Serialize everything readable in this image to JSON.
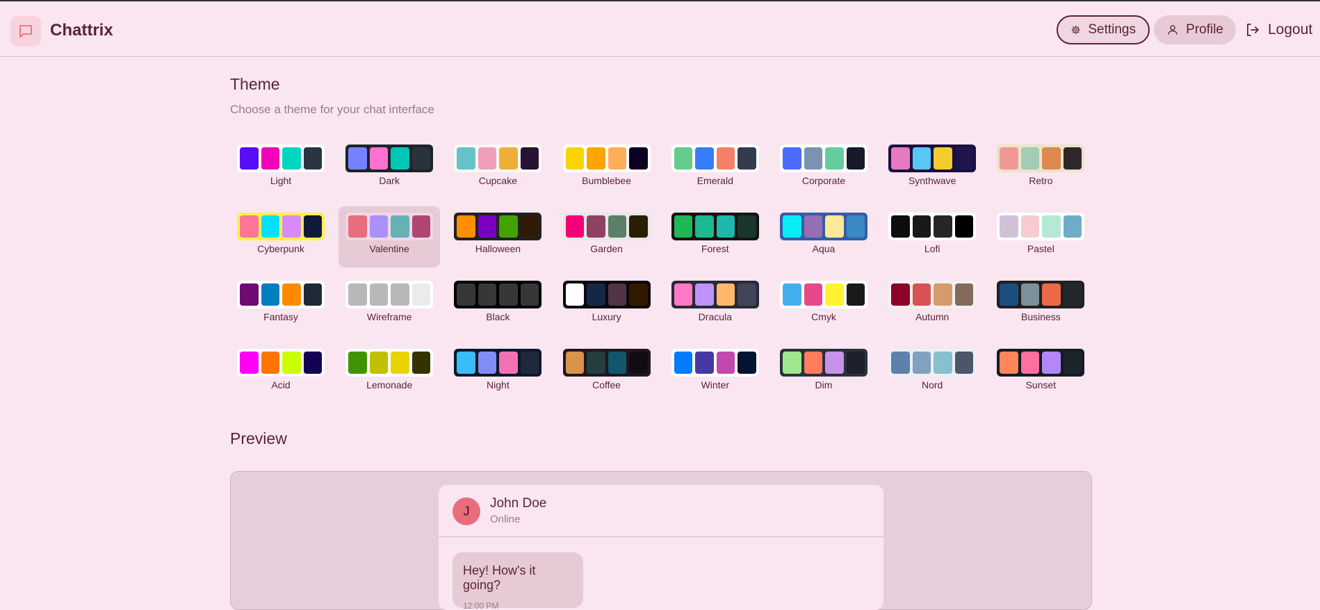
{
  "header": {
    "app_name": "Chattrix",
    "settings_label": "Settings",
    "profile_label": "Profile",
    "logout_label": "Logout"
  },
  "theme_section": {
    "title": "Theme",
    "subtitle": "Choose a theme for your chat interface",
    "selected": "Valentine"
  },
  "themes": [
    {
      "name": "Light",
      "bg": "#ffffff",
      "colors": [
        "#570df8",
        "#f000b8",
        "#00d7c0",
        "#2b3440"
      ]
    },
    {
      "name": "Dark",
      "bg": "#1d232a",
      "colors": [
        "#7582ff",
        "#ff71cf",
        "#00c7b5",
        "#2a323c"
      ]
    },
    {
      "name": "Cupcake",
      "bg": "#faf7f5",
      "colors": [
        "#65c3c8",
        "#ef9fbc",
        "#eeaf3a",
        "#291334"
      ]
    },
    {
      "name": "Bumblebee",
      "bg": "#ffffff",
      "colors": [
        "#fad302",
        "#ffa500",
        "#ffad57",
        "#0c0022"
      ]
    },
    {
      "name": "Emerald",
      "bg": "#ffffff",
      "colors": [
        "#66cc8a",
        "#377cfb",
        "#f68067",
        "#333c4d"
      ]
    },
    {
      "name": "Corporate",
      "bg": "#ffffff",
      "colors": [
        "#4b6bfb",
        "#7b92b2",
        "#67cba0",
        "#181a2a"
      ]
    },
    {
      "name": "Synthwave",
      "bg": "#1a103d",
      "colors": [
        "#e779c1",
        "#58c7f3",
        "#f3cc30",
        "#20134e"
      ]
    },
    {
      "name": "Retro",
      "bg": "#ece3ca",
      "colors": [
        "#ef9995",
        "#a4cbb4",
        "#dc8850",
        "#2e282a"
      ]
    },
    {
      "name": "Cyberpunk",
      "bg": "#fff248",
      "colors": [
        "#ff7598",
        "#00e1ff",
        "#d88af9",
        "#111a3b"
      ]
    },
    {
      "name": "Valentine",
      "bg": "#f0d6e8",
      "colors": [
        "#e96d7b",
        "#a991f7",
        "#66b1b3",
        "#af4670"
      ]
    },
    {
      "name": "Halloween",
      "bg": "#212121",
      "colors": [
        "#ff8f00",
        "#7a00c3",
        "#42a200",
        "#2f1b05"
      ]
    },
    {
      "name": "Garden",
      "bg": "#e9e7e7",
      "colors": [
        "#f40076",
        "#8e4162",
        "#5c7f67",
        "#291e00"
      ]
    },
    {
      "name": "Forest",
      "bg": "#171212",
      "colors": [
        "#1eb854",
        "#1db88e",
        "#1db8ab",
        "#19362d"
      ]
    },
    {
      "name": "Aqua",
      "bg": "#345da7",
      "colors": [
        "#09ecf3",
        "#966fb3",
        "#ffe999",
        "#3b8ac4"
      ]
    },
    {
      "name": "Lofi",
      "bg": "#ffffff",
      "colors": [
        "#0d0d0d",
        "#1a1919",
        "#262626",
        "#000000"
      ]
    },
    {
      "name": "Pastel",
      "bg": "#ffffff",
      "colors": [
        "#d1c1d7",
        "#f6cbd1",
        "#b4e9d6",
        "#70acc7"
      ]
    },
    {
      "name": "Fantasy",
      "bg": "#ffffff",
      "colors": [
        "#6e0b75",
        "#007ebd",
        "#ff8a00",
        "#1f2937"
      ]
    },
    {
      "name": "Wireframe",
      "bg": "#ffffff",
      "colors": [
        "#b8b8b8",
        "#b8b8b8",
        "#b8b8b8",
        "#ebebeb"
      ]
    },
    {
      "name": "Black",
      "bg": "#000000",
      "colors": [
        "#373737",
        "#373737",
        "#373737",
        "#373737"
      ]
    },
    {
      "name": "Luxury",
      "bg": "#09090b",
      "colors": [
        "#ffffff",
        "#152747",
        "#513448",
        "#331800"
      ]
    },
    {
      "name": "Dracula",
      "bg": "#282a36",
      "colors": [
        "#ff79c6",
        "#bd93f9",
        "#ffb86c",
        "#414558"
      ]
    },
    {
      "name": "Cmyk",
      "bg": "#ffffff",
      "colors": [
        "#45aeee",
        "#e8488a",
        "#fff232",
        "#1a1a1a"
      ]
    },
    {
      "name": "Autumn",
      "bg": "#f1f1f1",
      "colors": [
        "#8c0327",
        "#d85251",
        "#d59b6a",
        "#826a5c"
      ]
    },
    {
      "name": "Business",
      "bg": "#202020",
      "colors": [
        "#1c4e80",
        "#7c909a",
        "#ea6947",
        "#23282e"
      ]
    },
    {
      "name": "Acid",
      "bg": "#fafafa",
      "colors": [
        "#ff00f4",
        "#ff7400",
        "#cbfd03",
        "#140152"
      ]
    },
    {
      "name": "Lemonade",
      "bg": "#ffffff",
      "colors": [
        "#419400",
        "#bfc100",
        "#e9d300",
        "#333300"
      ]
    },
    {
      "name": "Night",
      "bg": "#0f172a",
      "colors": [
        "#38bdf8",
        "#818cf8",
        "#f471b5",
        "#1e293b"
      ]
    },
    {
      "name": "Coffee",
      "bg": "#20161f",
      "colors": [
        "#db924b",
        "#263e3f",
        "#10576d",
        "#120c12"
      ]
    },
    {
      "name": "Winter",
      "bg": "#ffffff",
      "colors": [
        "#047aff",
        "#463aa2",
        "#c148ac",
        "#021431"
      ]
    },
    {
      "name": "Dim",
      "bg": "#2a303c",
      "colors": [
        "#9fe88d",
        "#ff7d5c",
        "#c792e9",
        "#1c212b"
      ]
    },
    {
      "name": "Nord",
      "bg": "#eceff4",
      "colors": [
        "#5e81ac",
        "#81a1c1",
        "#88c0d0",
        "#4c566a"
      ]
    },
    {
      "name": "Sunset",
      "bg": "#121c22",
      "colors": [
        "#ff865b",
        "#fd6f9c",
        "#b387fa",
        "#1b262c"
      ]
    }
  ],
  "preview": {
    "title": "Preview",
    "contact_initial": "J",
    "contact_name": "John Doe",
    "contact_status": "Online",
    "message_text": "Hey! How's it going?",
    "message_time": "12:00 PM"
  },
  "colors": {
    "page_bg": "#f9e6f0",
    "accent": "#5b2338",
    "muted": "#9c7a89"
  }
}
